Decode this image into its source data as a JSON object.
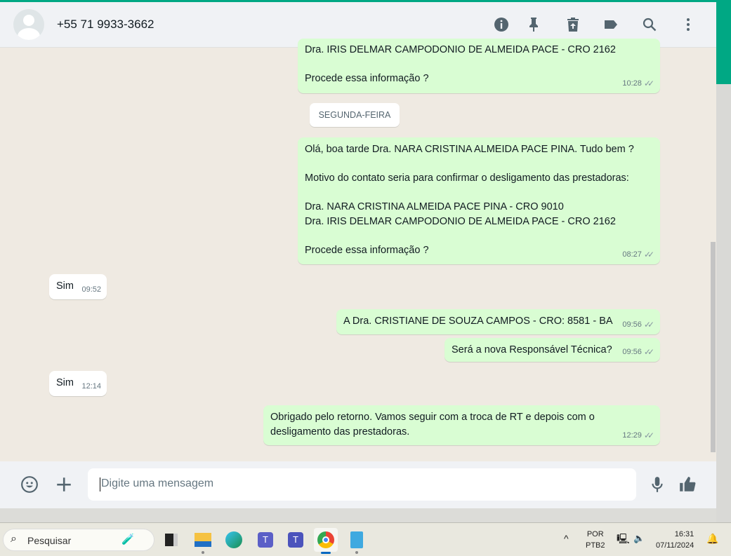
{
  "header": {
    "contact": "+55 71 9933-3662",
    "icons": [
      "info-icon",
      "pin-icon",
      "delete-icon",
      "label-icon",
      "search-icon",
      "menu-icon"
    ]
  },
  "messages": [
    {
      "dir": "out",
      "lines": [
        "Dra. IRIS DELMAR CAMPODONIO DE ALMEIDA PACE - CRO 2162",
        "",
        "Procede essa informação ?"
      ],
      "time": "10:28"
    },
    {
      "dir": "out",
      "lines": [
        "Olá, boa tarde Dra. NARA CRISTINA ALMEIDA PACE PINA. Tudo bem ?",
        "",
        "Motivo do contato seria para confirmar o desligamento das prestadoras:",
        "",
        "Dra. NARA CRISTINA ALMEIDA PACE PINA - CRO 9010",
        "Dra. IRIS DELMAR CAMPODONIO DE ALMEIDA PACE - CRO 2162",
        "",
        "Procede essa informação ?"
      ],
      "time": "08:27"
    },
    {
      "dir": "in",
      "lines": [
        "Sim"
      ],
      "time": "09:52"
    },
    {
      "dir": "out",
      "lines": [
        "A Dra. CRISTIANE DE SOUZA CAMPOS - CRO: 8581 - BA"
      ],
      "time": "09:56"
    },
    {
      "dir": "out",
      "lines": [
        "Será a nova Responsável Técnica?"
      ],
      "time": "09:56"
    },
    {
      "dir": "in",
      "lines": [
        "Sim"
      ],
      "time": "12:14"
    },
    {
      "dir": "out",
      "lines": [
        "Obrigado pelo retorno. Vamos seguir com a troca de RT e depois com o",
        "desligamento das prestadoras."
      ],
      "time": "12:29"
    }
  ],
  "date_divider": "SEGUNDA-FEIRA",
  "composer": {
    "placeholder": "Digite uma mensagem"
  },
  "taskbar": {
    "search": "Pesquisar",
    "lang1": "POR",
    "lang2": "PTB2",
    "time": "16:31",
    "date": "07/11/2024"
  }
}
